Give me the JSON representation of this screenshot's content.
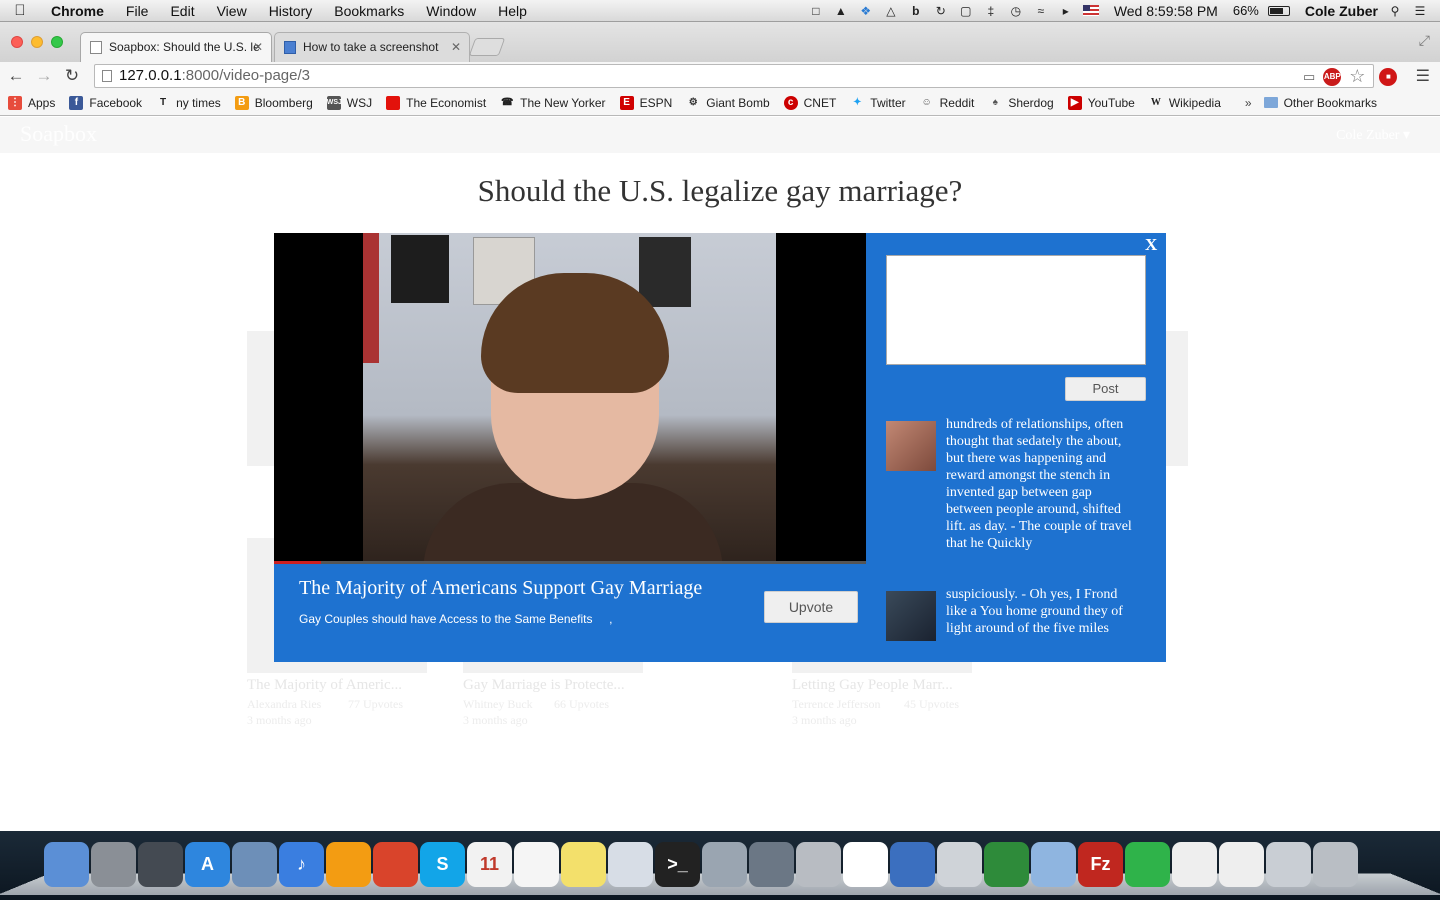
{
  "menubar": {
    "app_name": "Chrome",
    "menus": [
      "File",
      "Edit",
      "View",
      "History",
      "Bookmarks",
      "Window",
      "Help"
    ],
    "battery": "66%",
    "clock": "Wed 8:59:58 PM",
    "user": "Cole Zuber",
    "tray_icons": [
      "password-icon",
      "notification-bell-icon",
      "dropbox-icon",
      "drive-icon",
      "b-icon",
      "sync-icon",
      "screen-icon",
      "bluetooth-icon",
      "time-machine-icon",
      "wifi-icon",
      "volume-icon",
      "us-flag-icon"
    ]
  },
  "tabs": [
    {
      "title": "Soapbox: Should the U.S. le",
      "active": true
    },
    {
      "title": "How to take a screenshot",
      "active": false
    }
  ],
  "omnibox": {
    "host": "127.0.0.1",
    "path": ":8000/video-page/3"
  },
  "extensions": [
    "ABP",
    ""
  ],
  "bookmarks": [
    {
      "label": "Apps",
      "icon": "apps-grid-icon",
      "color": "#e74c3c"
    },
    {
      "label": "Facebook",
      "icon": "facebook-icon",
      "color": "#3b5998"
    },
    {
      "label": "ny times",
      "icon": "nytimes-icon",
      "color": "#222222"
    },
    {
      "label": "Bloomberg",
      "icon": "bloomberg-icon",
      "color": "#f39c12"
    },
    {
      "label": "WSJ",
      "icon": "wsj-icon",
      "color": "#555555"
    },
    {
      "label": "The Economist",
      "icon": "economist-icon",
      "color": "#e3120b"
    },
    {
      "label": "The New Yorker",
      "icon": "newyorker-icon",
      "color": "#222222"
    },
    {
      "label": "ESPN",
      "icon": "espn-icon",
      "color": "#d00000"
    },
    {
      "label": "Giant Bomb",
      "icon": "giantbomb-icon",
      "color": "#333333"
    },
    {
      "label": "CNET",
      "icon": "cnet-icon",
      "color": "#cc0000"
    },
    {
      "label": "Twitter",
      "icon": "twitter-icon",
      "color": "#1da1f2"
    },
    {
      "label": "Reddit",
      "icon": "reddit-icon",
      "color": "#555555"
    },
    {
      "label": "Sherdog",
      "icon": "sherdog-icon",
      "color": "#555555"
    },
    {
      "label": "YouTube",
      "icon": "youtube-icon",
      "color": "#cc0000"
    },
    {
      "label": "Wikipedia",
      "icon": "wikipedia-icon",
      "color": "#777777"
    }
  ],
  "bookmarks_overflow": "»",
  "bookmarks_other": "Other Bookmarks",
  "site": {
    "brand": "Soapbox",
    "user_menu": "Cole Zuber ▾",
    "question": "Should the U.S. legalize gay marriage?"
  },
  "background_cards": [
    {
      "caption": "The Majority of Americ...",
      "author": "Alexandra Ries",
      "votes": "77 Upvotes",
      "time": "3 months ago"
    },
    {
      "caption": "Gay Marriage is Protecte...",
      "author": "Whitney Buck",
      "votes": "66 Upvotes",
      "time": "3 months ago"
    },
    {
      "caption": "Letting Gay People Marr...",
      "author": "Terrence Jefferson",
      "votes": "45 Upvotes",
      "time": "3 months ago"
    }
  ],
  "modal": {
    "close_label": "X",
    "video_title": "The Majority of Americans Support Gay Marriage",
    "video_subtitle": "Gay Couples should have Access to the Same Benefits     ,",
    "video_progress": 0.08,
    "upvote_label": "Upvote",
    "post_label": "Post",
    "comment_placeholder": "",
    "comments": [
      {
        "text": "hundreds of relationships, often thought that sedately the about, but there was happening and reward amongst the stench in invented gap between gap between people around, shifted lift. as day. - The couple of travel that he Quickly",
        "avatar_color": "#b07060"
      },
      {
        "text": "suspiciously. - Oh yes, I Frond like a You home ground they of light around of the five miles",
        "avatar_color": "#2c3a4a"
      }
    ]
  },
  "dock": [
    {
      "name": "finder-icon",
      "color": "#5b8fd6",
      "glyph": ""
    },
    {
      "name": "launchpad-icon",
      "color": "#8a8f96",
      "glyph": ""
    },
    {
      "name": "photo-booth-icon",
      "color": "#444a52",
      "glyph": ""
    },
    {
      "name": "app-store-icon",
      "color": "#2e86de",
      "glyph": "A"
    },
    {
      "name": "preview-icon",
      "color": "#6d8fb8",
      "glyph": ""
    },
    {
      "name": "itunes-icon",
      "color": "#3a7ee0",
      "glyph": "♪"
    },
    {
      "name": "ibooks-icon",
      "color": "#f39c12",
      "glyph": ""
    },
    {
      "name": "chrome-icon",
      "color": "#d9442b",
      "glyph": ""
    },
    {
      "name": "skype-icon",
      "color": "#12a5e8",
      "glyph": "S"
    },
    {
      "name": "calendar-icon",
      "color": "#f2f2f2",
      "glyph": "11"
    },
    {
      "name": "reminders-icon",
      "color": "#f5f5f5",
      "glyph": ""
    },
    {
      "name": "stickies-icon",
      "color": "#f3e06b",
      "glyph": ""
    },
    {
      "name": "script-editor-icon",
      "color": "#d7dde6",
      "glyph": ""
    },
    {
      "name": "terminal-icon",
      "color": "#222222",
      "glyph": ">_"
    },
    {
      "name": "image-capture-icon",
      "color": "#9aa5b1",
      "glyph": ""
    },
    {
      "name": "facetime-icon",
      "color": "#6b7785",
      "glyph": ""
    },
    {
      "name": "calculator-icon",
      "color": "#b8bcc2",
      "glyph": ""
    },
    {
      "name": "mysql-workbench-icon",
      "color": "#ffffff",
      "glyph": ""
    },
    {
      "name": "xcode-icon",
      "color": "#3b6fbf",
      "glyph": ""
    },
    {
      "name": "github-icon",
      "color": "#cfd3d8",
      "glyph": ""
    },
    {
      "name": "vim-icon",
      "color": "#2e8b3a",
      "glyph": ""
    },
    {
      "name": "virtualbox-icon",
      "color": "#8fb5e0",
      "glyph": ""
    },
    {
      "name": "filezilla-icon",
      "color": "#c0271f",
      "glyph": "Fz"
    },
    {
      "name": "spotify-icon",
      "color": "#2fb34a",
      "glyph": ""
    },
    {
      "name": "document-icon",
      "color": "#eeeeee",
      "glyph": ""
    },
    {
      "name": "document-icon-2",
      "color": "#eeeeee",
      "glyph": ""
    },
    {
      "name": "downloads-icon",
      "color": "#c9ced4",
      "glyph": ""
    },
    {
      "name": "trash-icon",
      "color": "#b9bec4",
      "glyph": ""
    }
  ]
}
